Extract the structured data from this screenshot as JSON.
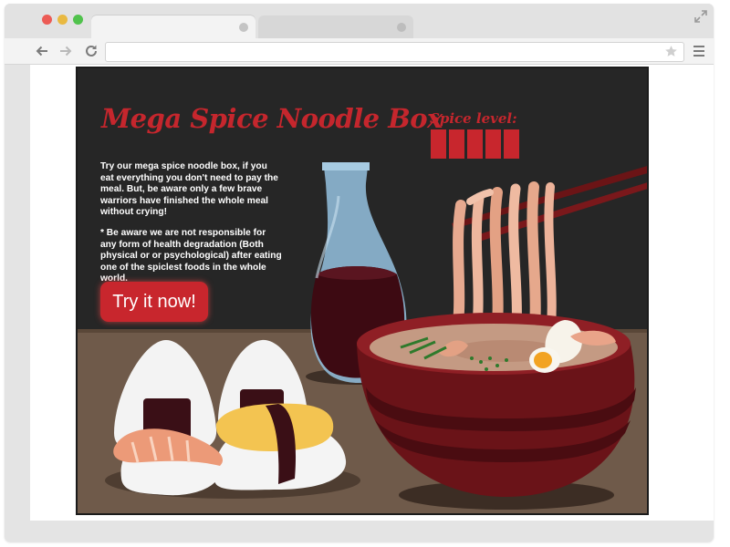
{
  "page": {
    "title": "Mega Spice Noodle Box",
    "spice_label": "Spice level:",
    "spice_level": 5,
    "spice_max": 5,
    "description": "Try our mega spice noodle box, if you eat everything you don't need to pay the meal. But, be aware only a few brave warriors have finished the whole meal without crying!",
    "disclaimer": "* Be aware we are not responsible for any form of health degradation (Both physical or or psychological) after eating one of the spiclest foods in the whole world.",
    "cta_label": "Try it now!"
  },
  "colors": {
    "accent": "#c8262d",
    "hero_background": "#262626",
    "table": "#6f5a4a"
  }
}
